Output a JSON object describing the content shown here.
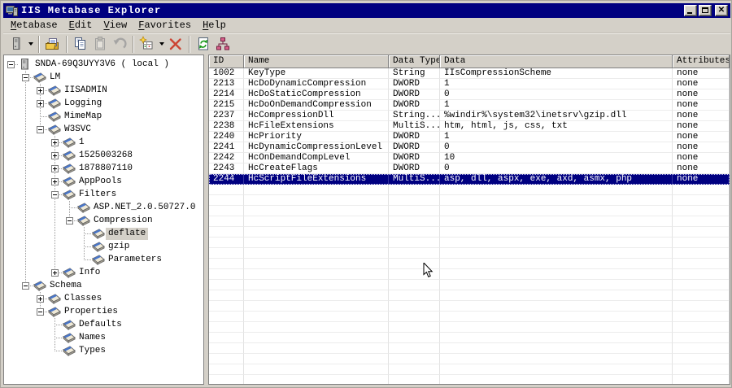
{
  "window": {
    "title": "IIS Metabase Explorer"
  },
  "titlebar": {
    "buttons": [
      "minimize",
      "maximize",
      "close"
    ]
  },
  "menu": {
    "items": [
      {
        "label": "Metabase"
      },
      {
        "label": "Edit"
      },
      {
        "label": "View"
      },
      {
        "label": "Favorites"
      },
      {
        "label": "Help"
      }
    ]
  },
  "toolbar": {
    "items": [
      {
        "name": "connect-computer-button",
        "icon": "computer-icon",
        "dropdown": true,
        "enabled": true
      },
      {
        "separator": true
      },
      {
        "name": "open-button",
        "icon": "open-folder-icon",
        "enabled": true
      },
      {
        "separator": true
      },
      {
        "name": "copy-button",
        "icon": "copy-icon",
        "enabled": true
      },
      {
        "name": "paste-button",
        "icon": "paste-icon",
        "enabled": false
      },
      {
        "name": "undo-button",
        "icon": "undo-icon",
        "enabled": false
      },
      {
        "separator": true
      },
      {
        "name": "new-record-button",
        "icon": "new-record-icon",
        "dropdown": true,
        "enabled": true
      },
      {
        "name": "delete-button",
        "icon": "delete-icon",
        "enabled": true
      },
      {
        "separator": true
      },
      {
        "name": "refresh-button",
        "icon": "refresh-icon",
        "enabled": true
      },
      {
        "name": "view-tree-button",
        "icon": "tree-view-icon",
        "enabled": true
      }
    ]
  },
  "tree": {
    "items": [
      {
        "label": "SNDA-69Q3UYY3V6 ( local )",
        "level": 0,
        "expander": "minus",
        "icon": "computer",
        "selected": false
      },
      {
        "label": "LM",
        "level": 1,
        "expander": "minus",
        "icon": "key",
        "selected": false
      },
      {
        "label": "IISADMIN",
        "level": 2,
        "expander": "plus",
        "icon": "key",
        "selected": false
      },
      {
        "label": "Logging",
        "level": 2,
        "expander": "plus",
        "icon": "key",
        "selected": false
      },
      {
        "label": "MimeMap",
        "level": 2,
        "expander": null,
        "icon": "key",
        "selected": false
      },
      {
        "label": "W3SVC",
        "level": 2,
        "expander": "minus",
        "icon": "key",
        "selected": false
      },
      {
        "label": "1",
        "level": 3,
        "expander": "plus",
        "icon": "key",
        "selected": false
      },
      {
        "label": "1525003268",
        "level": 3,
        "expander": "plus",
        "icon": "key",
        "selected": false
      },
      {
        "label": "1878807110",
        "level": 3,
        "expander": "plus",
        "icon": "key",
        "selected": false
      },
      {
        "label": "AppPools",
        "level": 3,
        "expander": "plus",
        "icon": "key",
        "selected": false
      },
      {
        "label": "Filters",
        "level": 3,
        "expander": "minus",
        "icon": "key",
        "selected": false
      },
      {
        "label": "ASP.NET_2.0.50727.0",
        "level": 4,
        "expander": null,
        "icon": "key",
        "selected": false
      },
      {
        "label": "Compression",
        "level": 4,
        "expander": "minus",
        "icon": "key",
        "selected": false
      },
      {
        "label": "deflate",
        "level": 5,
        "expander": null,
        "icon": "key",
        "selected": true
      },
      {
        "label": "gzip",
        "level": 5,
        "expander": null,
        "icon": "key",
        "selected": false
      },
      {
        "label": "Parameters",
        "level": 5,
        "expander": null,
        "icon": "key",
        "selected": false
      },
      {
        "label": "Info",
        "level": 3,
        "expander": "plus",
        "icon": "key",
        "selected": false
      },
      {
        "label": "Schema",
        "level": 1,
        "expander": "minus",
        "icon": "key",
        "selected": false
      },
      {
        "label": "Classes",
        "level": 2,
        "expander": "plus",
        "icon": "key",
        "selected": false
      },
      {
        "label": "Properties",
        "level": 2,
        "expander": "minus",
        "icon": "key",
        "selected": false
      },
      {
        "label": "Defaults",
        "level": 3,
        "expander": null,
        "icon": "key",
        "selected": false
      },
      {
        "label": "Names",
        "level": 3,
        "expander": null,
        "icon": "key",
        "selected": false
      },
      {
        "label": "Types",
        "level": 3,
        "expander": null,
        "icon": "key",
        "selected": false
      }
    ]
  },
  "list": {
    "columns": [
      "ID",
      "Name",
      "Data Type",
      "Data",
      "Attributes"
    ],
    "rows": [
      {
        "id": "1002",
        "name": "KeyType",
        "type": "String",
        "data": "IIsCompressionScheme",
        "attributes": "none",
        "selected": false
      },
      {
        "id": "2213",
        "name": "HcDoDynamicCompression",
        "type": "DWORD",
        "data": "1",
        "attributes": "none",
        "selected": false
      },
      {
        "id": "2214",
        "name": "HcDoStaticCompression",
        "type": "DWORD",
        "data": "0",
        "attributes": "none",
        "selected": false
      },
      {
        "id": "2215",
        "name": "HcDoOnDemandCompression",
        "type": "DWORD",
        "data": "1",
        "attributes": "none",
        "selected": false
      },
      {
        "id": "2237",
        "name": "HcCompressionDll",
        "type": "String...",
        "data": "%windir%\\system32\\inetsrv\\gzip.dll",
        "attributes": "none",
        "selected": false
      },
      {
        "id": "2238",
        "name": "HcFileExtensions",
        "type": "MultiS...",
        "data": "htm, html, js, css, txt",
        "attributes": "none",
        "selected": false
      },
      {
        "id": "2240",
        "name": "HcPriority",
        "type": "DWORD",
        "data": "1",
        "attributes": "none",
        "selected": false
      },
      {
        "id": "2241",
        "name": "HcDynamicCompressionLevel",
        "type": "DWORD",
        "data": "0",
        "attributes": "none",
        "selected": false
      },
      {
        "id": "2242",
        "name": "HcOnDemandCompLevel",
        "type": "DWORD",
        "data": "10",
        "attributes": "none",
        "selected": false
      },
      {
        "id": "2243",
        "name": "HcCreateFlags",
        "type": "DWORD",
        "data": "0",
        "attributes": "none",
        "selected": false
      },
      {
        "id": "2244",
        "name": "HcScriptFileExtensions",
        "type": "MultiS...",
        "data": "asp, dll, aspx, exe, axd, asmx, php",
        "attributes": "none",
        "selected": true
      }
    ]
  },
  "colors": {
    "titlebar": "#000080",
    "selection": "#000080",
    "chrome": "#d4d0c8",
    "tree_inactive_selection": "#d4d0c8"
  }
}
